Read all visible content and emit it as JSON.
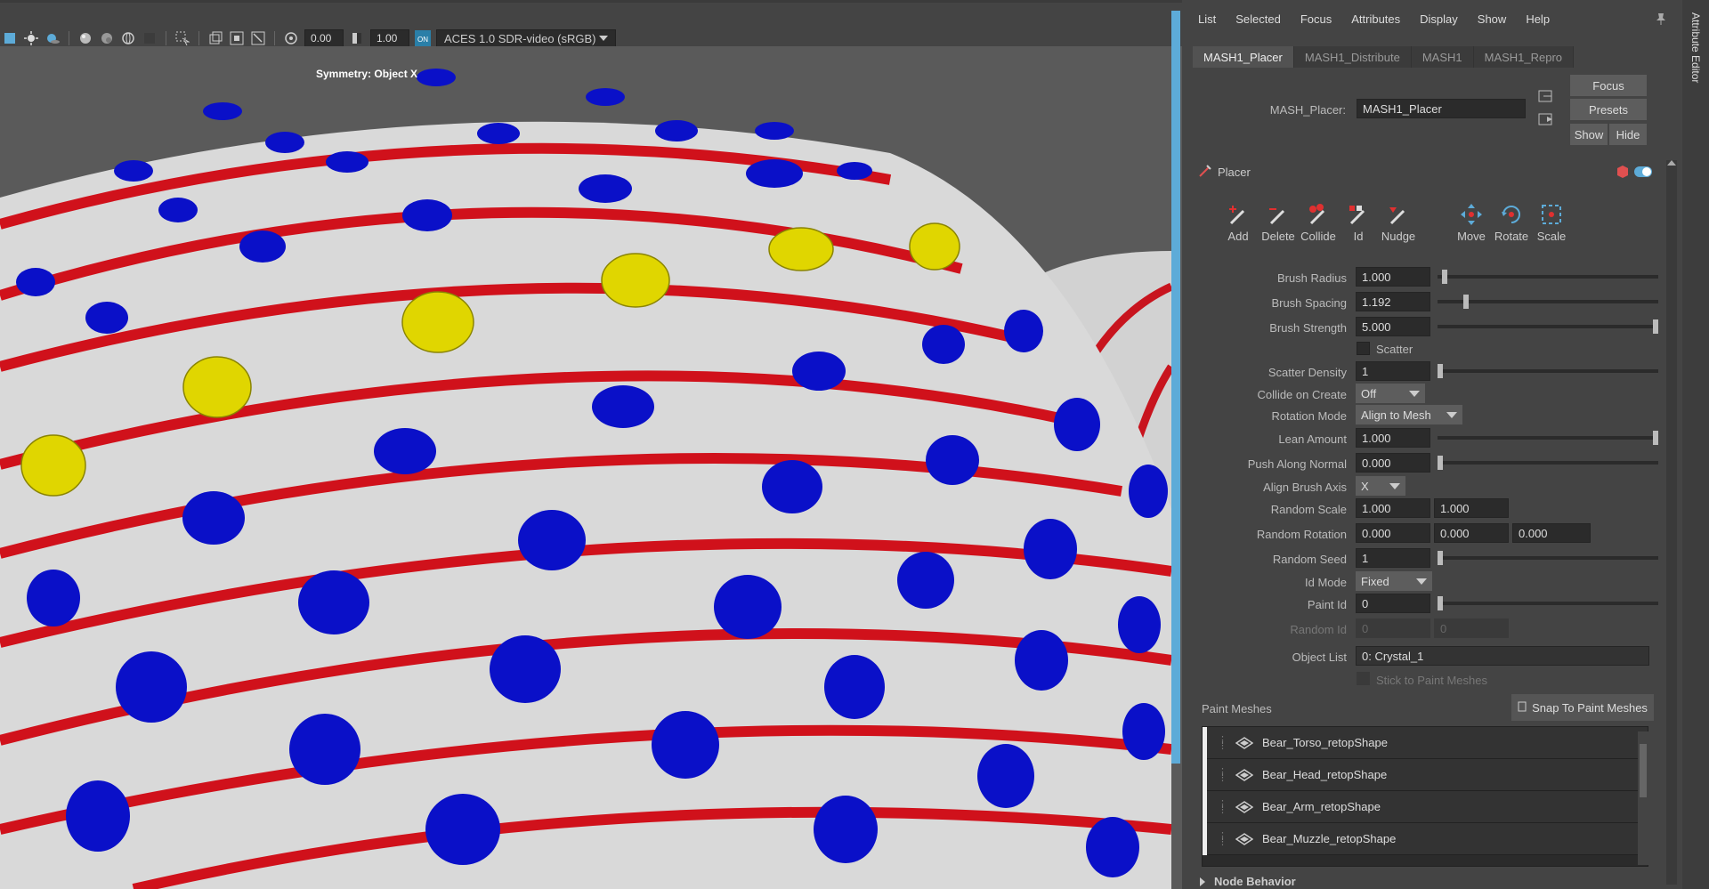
{
  "viewport": {
    "toolbar": {
      "exposure": "0.00",
      "gamma": "1.00",
      "color_space": "ACES 1.0 SDR-video (sRGB)",
      "icons": [
        "xray-icon",
        "light-icon",
        "shadow-icon",
        "sphere-icon",
        "sphere-shaded-icon",
        "sphere-wire-icon",
        "isolate-icon",
        "select-icon",
        "frame-icon",
        "frame-all-icon",
        "snap-icon",
        "exposure-icon",
        "gamma-icon",
        "color-management-icon"
      ]
    },
    "symmetry_label": "Symmetry: Object X"
  },
  "ae": {
    "menu": [
      "List",
      "Selected",
      "Focus",
      "Attributes",
      "Display",
      "Show",
      "Help"
    ],
    "side_label": "Attribute Editor",
    "tabs": [
      "MASH1_Placer",
      "MASH1_Distribute",
      "MASH1",
      "MASH1_Repro"
    ],
    "active_tab": "MASH1_Placer",
    "node_label": "MASH_Placer:",
    "node_value": "MASH1_Placer",
    "buttons": {
      "focus": "Focus",
      "presets": "Presets",
      "show": "Show",
      "hide": "Hide"
    },
    "frame_title": "Placer",
    "tools": [
      "Add",
      "Delete",
      "Collide",
      "Id",
      "Nudge",
      "Move",
      "Rotate",
      "Scale"
    ],
    "attrs": {
      "brush_radius": {
        "label": "Brush Radius",
        "value": "1.000",
        "slider": 0.02
      },
      "brush_spacing": {
        "label": "Brush Spacing",
        "value": "1.192",
        "slider": 0.12
      },
      "brush_strength": {
        "label": "Brush Strength",
        "value": "5.000",
        "slider": 1.0
      },
      "scatter": {
        "label": "Scatter",
        "checked": false
      },
      "scatter_density": {
        "label": "Scatter Density",
        "value": "1",
        "slider": 0.0
      },
      "collide_on_create": {
        "label": "Collide on Create",
        "value": "Off"
      },
      "rotation_mode": {
        "label": "Rotation Mode",
        "value": "Align to Mesh"
      },
      "lean_amount": {
        "label": "Lean Amount",
        "value": "1.000",
        "slider": 1.0
      },
      "push_along_normal": {
        "label": "Push Along Normal",
        "value": "0.000",
        "slider": 0.0
      },
      "align_brush_axis": {
        "label": "Align Brush Axis",
        "value": "X"
      },
      "random_scale": {
        "label": "Random Scale",
        "values": [
          "1.000",
          "1.000"
        ]
      },
      "random_rotation": {
        "label": "Random Rotation",
        "values": [
          "0.000",
          "0.000",
          "0.000"
        ]
      },
      "random_seed": {
        "label": "Random Seed",
        "value": "1",
        "slider": 0.0
      },
      "id_mode": {
        "label": "Id Mode",
        "value": "Fixed"
      },
      "paint_id": {
        "label": "Paint Id",
        "value": "0",
        "slider": 0.0
      },
      "random_id": {
        "label": "Random Id",
        "values": [
          "0",
          "0"
        ]
      },
      "object_list": {
        "label": "Object List",
        "value": "0: Crystal_1"
      },
      "stick_to_paint_meshes": {
        "label": "Stick to Paint Meshes",
        "checked": false
      }
    },
    "paint_meshes": {
      "label": "Paint Meshes",
      "snap_button": "Snap To Paint Meshes",
      "items": [
        "Bear_Torso_retopShape",
        "Bear_Head_retopShape",
        "Bear_Arm_retopShape",
        "Bear_Muzzle_retopShape"
      ]
    },
    "node_behavior": "Node Behavior"
  }
}
